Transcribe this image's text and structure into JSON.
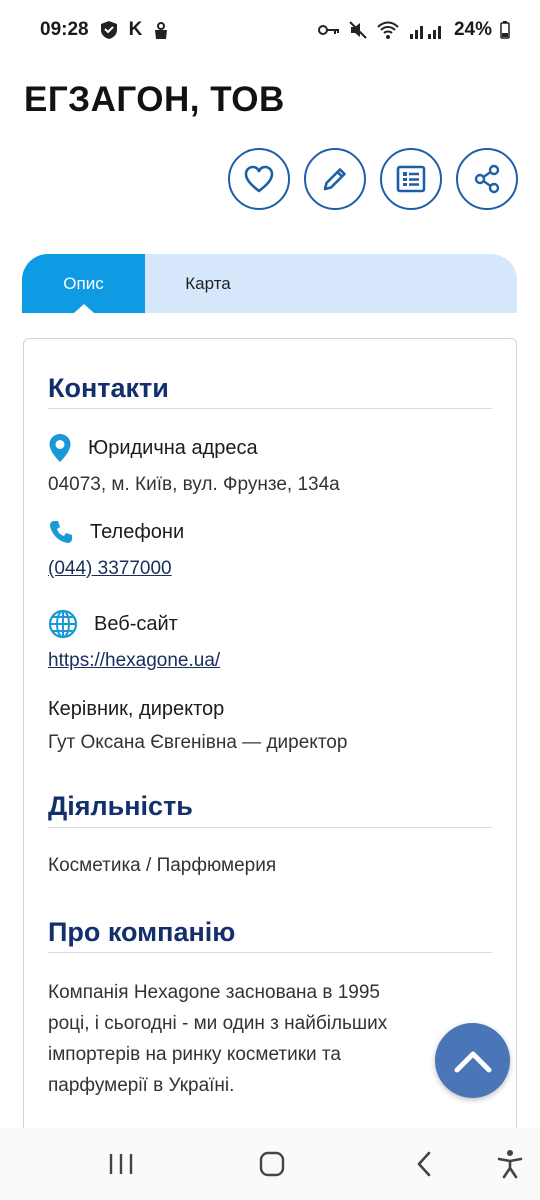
{
  "status_bar": {
    "time": "09:28",
    "carrier_letter": "K",
    "battery": "24%",
    "left_icons": [
      "shield-icon",
      "bag-icon"
    ],
    "right_icons": [
      "key-icon",
      "mute-icon",
      "wifi-icon",
      "signal-icon"
    ]
  },
  "company": {
    "title": "ЕГЗАГОН, ТОВ"
  },
  "actions": [
    "heart-icon",
    "pencil-icon",
    "list-icon",
    "share-icon"
  ],
  "tabs": [
    {
      "label": "Опис",
      "active": true
    },
    {
      "label": "Карта",
      "active": false
    }
  ],
  "contacts": {
    "title": "Контакти",
    "address_label": "Юридична адреса",
    "address_value": "04073, м. Київ, вул. Фрунзе, 134а",
    "phones_label": "Телефони",
    "phone_value": "(044) 3377000",
    "website_label": "Веб-сайт",
    "website_value": "https://hexagone.ua/",
    "director_label": "Керівник, директор",
    "director_value": "Гут Оксана Євгенівна — директор"
  },
  "activity": {
    "title": "Діяльність",
    "value": "Косметика / Парфюмерия"
  },
  "about": {
    "title": "Про компанію",
    "line1": "Компанія Hexagone заснована в 1995",
    "line2": "році, і сьогодні - ми один з найбільших",
    "line3": "імпортерів на ринку косметики та",
    "line4": "парфумерії в Україні."
  },
  "colors": {
    "accent": "#0f9ae4",
    "heading": "#14306c",
    "button_border": "#1c5fa8",
    "fab": "#4a76b7"
  }
}
